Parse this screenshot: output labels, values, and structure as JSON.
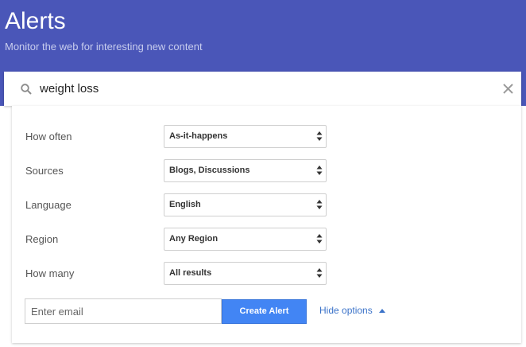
{
  "header": {
    "title": "Alerts",
    "subtitle": "Monitor the web for interesting new content",
    "background_color": "#4a56b8"
  },
  "search": {
    "icon": "search-icon",
    "value": "weight loss",
    "clear_icon": "close-icon"
  },
  "options": [
    {
      "label": "How often",
      "value": "As-it-happens"
    },
    {
      "label": "Sources",
      "value": "Blogs, Discussions"
    },
    {
      "label": "Language",
      "value": "English"
    },
    {
      "label": "Region",
      "value": "Any Region"
    },
    {
      "label": "How many",
      "value": "All results"
    }
  ],
  "email": {
    "placeholder": "Enter email"
  },
  "actions": {
    "create_label": "Create Alert",
    "create_color": "#4285f4",
    "hide_options_label": "Hide options",
    "hide_options_icon": "caret-up-icon"
  }
}
